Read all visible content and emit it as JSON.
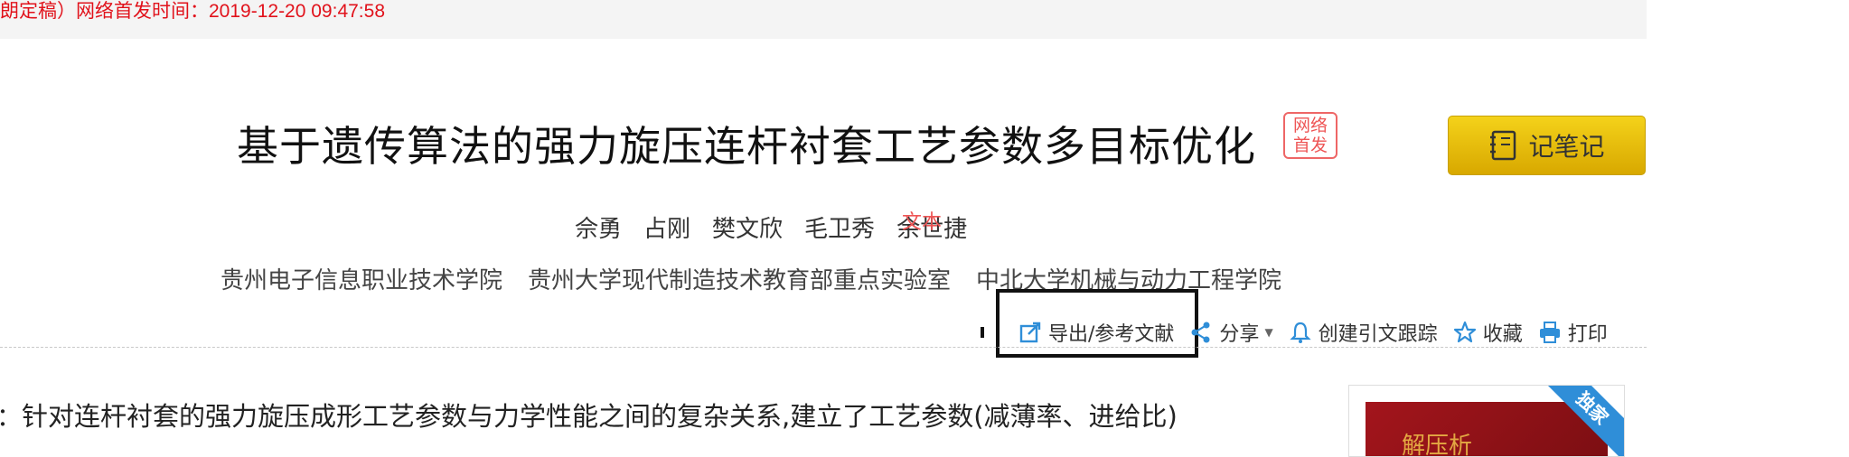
{
  "topbar": {
    "publish_text": "朗定稿）网络首发时间：2019-12-20 09:47:58"
  },
  "article": {
    "title": "基于遗传算法的强力旋压连杆衬套工艺参数多目标优化",
    "online_badge": "网络首发",
    "authors": [
      "佘勇",
      "占刚",
      "樊文欣",
      "毛卫秀",
      "余世捷"
    ],
    "overlay_text": "文本",
    "affiliations": [
      "贵州电子信息职业技术学院",
      "贵州大学现代制造技术教育部重点实验室",
      "中北大学机械与动力工程学院"
    ],
    "abstract_prefix": "：",
    "abstract": "针对连杆衬套的强力旋压成形工艺参数与力学性能之间的复杂关系,建立了工艺参数(减薄率、进给比)"
  },
  "note_button": {
    "label": "记笔记"
  },
  "toolbar": {
    "export": "导出/参考文献",
    "share": "分享",
    "track": "创建引文跟踪",
    "favorite": "收藏",
    "print": "打印"
  },
  "cover": {
    "ribbon": "独家",
    "script_text": "解压析"
  },
  "colors": {
    "accent_red": "#e1121b",
    "note_yellow": "#f4d21a",
    "link_blue": "#2f8ed8"
  }
}
